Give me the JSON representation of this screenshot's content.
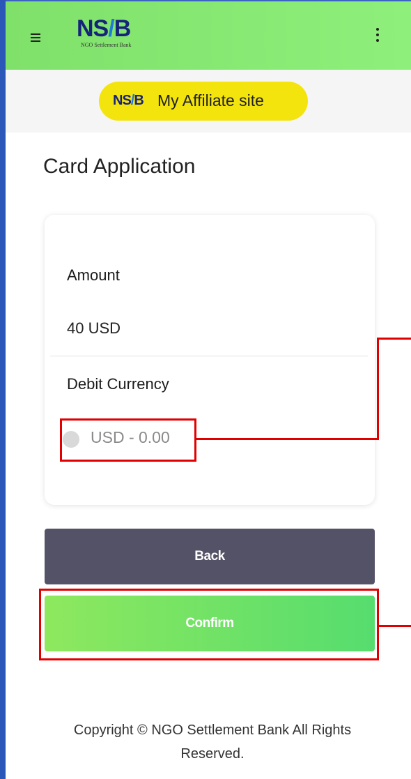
{
  "header": {
    "logo_mark": "NS",
    "logo_mark_b": "B",
    "logo_subtitle": "NGO Settlement Bank",
    "menu_icon": "hamburger-icon",
    "more_icon": "kebab-icon"
  },
  "affiliate": {
    "logo_mark": "NS",
    "logo_mark_b": "B",
    "label": "My Affiliate site"
  },
  "page": {
    "title": "Card Application"
  },
  "card": {
    "amount_label": "Amount",
    "amount_value": "40 USD",
    "currency_label": "Debit Currency",
    "currency_option": "USD - 0.00"
  },
  "buttons": {
    "back": "Back",
    "confirm": "Confirm"
  },
  "footer": {
    "line1": "Copyright © NGO Settlement Bank All Rights",
    "line2": "Reserved."
  },
  "colors": {
    "header_green": "#8ef07a",
    "affiliate_yellow": "#f4e40e",
    "back_button": "#545266",
    "confirm_green": "#56dd6e",
    "highlight_red": "#e10000",
    "frame_blue": "#2b58b8"
  }
}
